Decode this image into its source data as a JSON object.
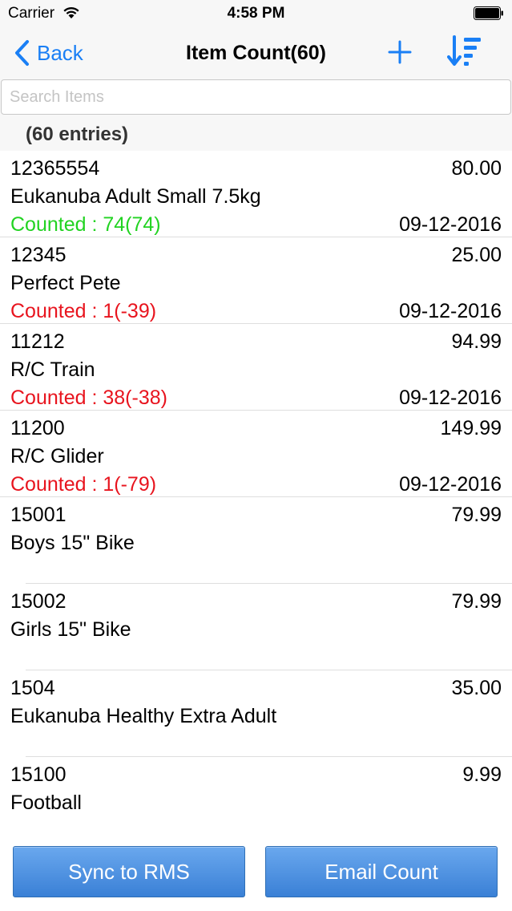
{
  "status_bar": {
    "carrier": "Carrier",
    "time": "4:58 PM"
  },
  "nav": {
    "back_label": "Back",
    "title": "Item Count(60)",
    "icons": {
      "add": "plus-icon",
      "sort": "sort-descending-icon"
    }
  },
  "search": {
    "placeholder": "Search Items",
    "value": ""
  },
  "section": {
    "header": "(60 entries)"
  },
  "items": [
    {
      "code": "12365554",
      "price": "80.00",
      "name": "Eukanuba Adult Small 7.5kg",
      "counted": "Counted : 74(74)",
      "counted_status": "match",
      "date": "09-12-2016"
    },
    {
      "code": "12345",
      "price": "25.00",
      "name": "Perfect Pete",
      "counted": "Counted : 1(-39)",
      "counted_status": "variance",
      "date": "09-12-2016"
    },
    {
      "code": "11212",
      "price": "94.99",
      "name": "R/C Train",
      "counted": "Counted : 38(-38)",
      "counted_status": "variance",
      "date": "09-12-2016"
    },
    {
      "code": "11200",
      "price": "149.99",
      "name": "R/C Glider",
      "counted": "Counted : 1(-79)",
      "counted_status": "variance",
      "date": "09-12-2016"
    },
    {
      "code": "15001",
      "price": "79.99",
      "name": "Boys 15\" Bike",
      "counted": "",
      "counted_status": "none",
      "date": ""
    },
    {
      "code": "15002",
      "price": "79.99",
      "name": "Girls 15\" Bike",
      "counted": "",
      "counted_status": "none",
      "date": ""
    },
    {
      "code": "1504",
      "price": "35.00",
      "name": "Eukanuba Healthy Extra Adult",
      "counted": "",
      "counted_status": "none",
      "date": ""
    },
    {
      "code": "15100",
      "price": "9.99",
      "name": "Football",
      "counted": "",
      "counted_status": "none",
      "date": ""
    }
  ],
  "toolbar": {
    "sync_label": "Sync to RMS",
    "email_label": "Email Count"
  },
  "colors": {
    "accent": "#1a7ff5",
    "counted_match": "#22d322",
    "counted_variance": "#e8141e",
    "button_top": "#6aa8ee",
    "button_bottom": "#3a80d6"
  }
}
